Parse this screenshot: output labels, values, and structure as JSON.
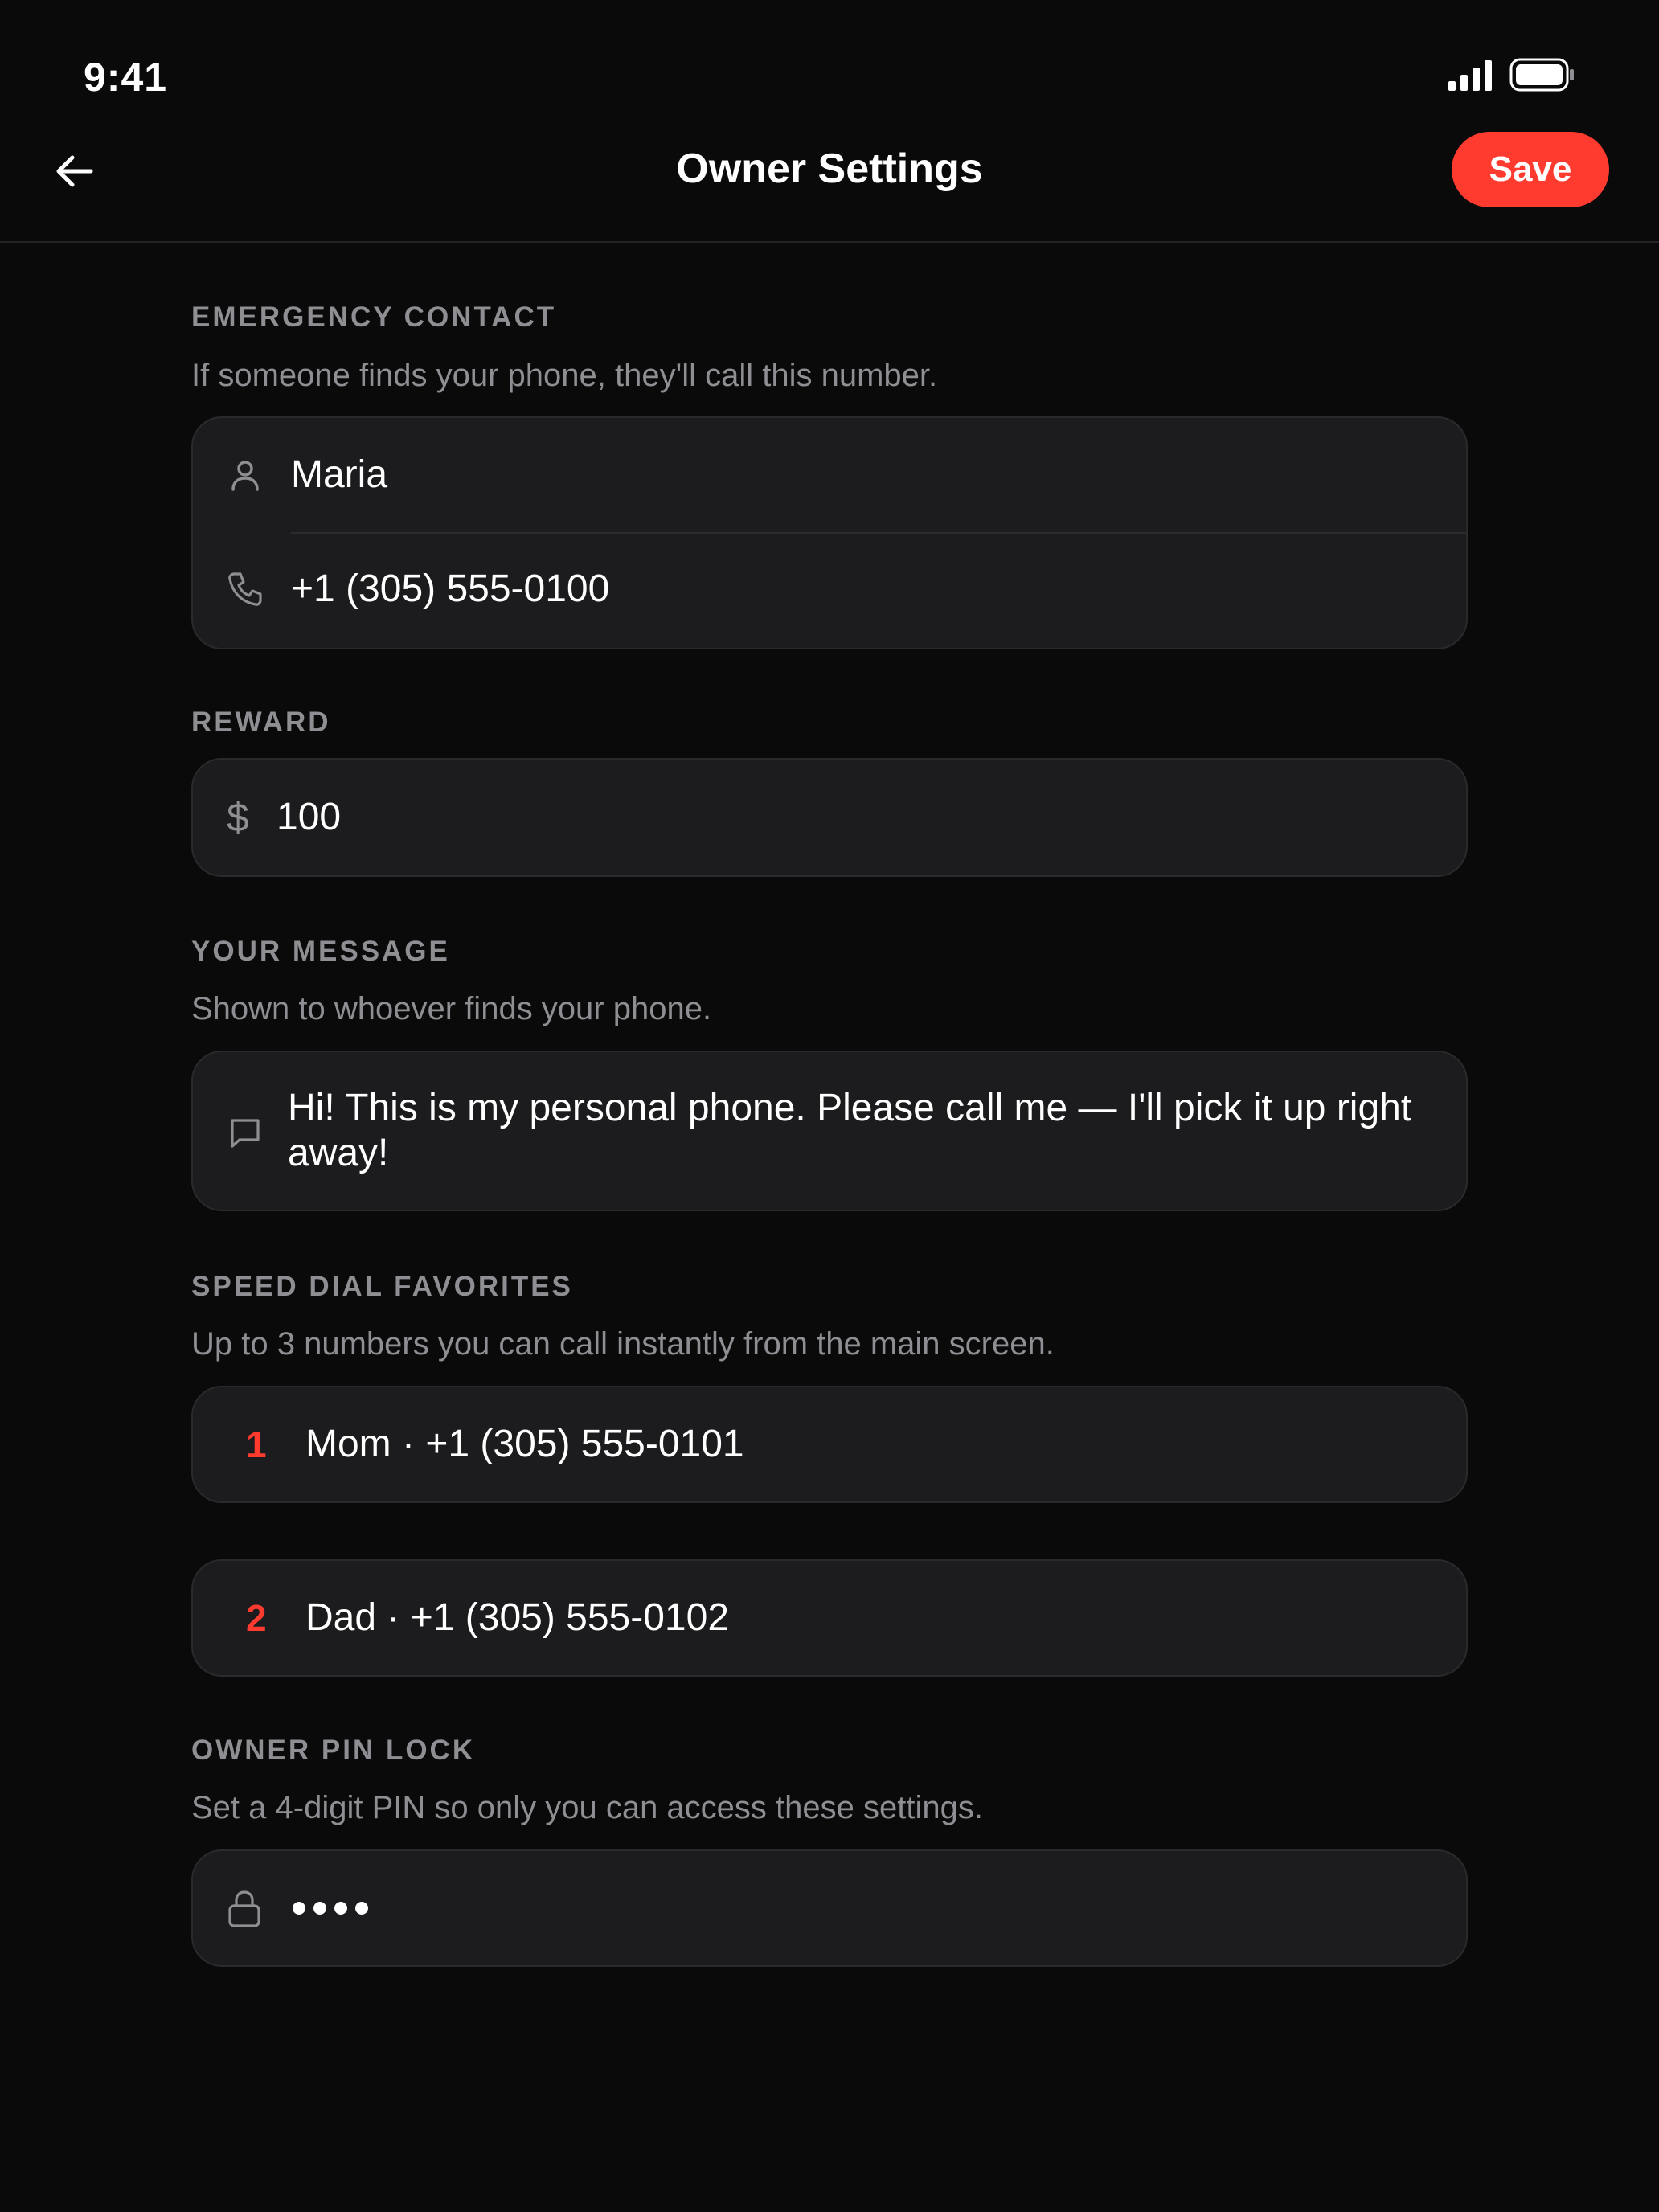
{
  "status_bar": {
    "time": "9:41",
    "signal_icon": "cellular-signal-icon",
    "battery_icon": "battery-icon"
  },
  "nav": {
    "title": "Owner Settings",
    "back_icon": "arrow-left-icon",
    "save_label": "Save"
  },
  "emergency_contact": {
    "label": "EMERGENCY CONTACT",
    "description": "If someone finds your phone, they'll call this number.",
    "name": "Maria",
    "phone": "+1 (305) 555-0100"
  },
  "reward": {
    "label": "REWARD",
    "currency_symbol": "$",
    "amount": "100"
  },
  "message": {
    "label": "YOUR MESSAGE",
    "description": "Shown to whoever finds your phone.",
    "text": "Hi! This is my personal phone. Please call me — I'll pick it up right away!"
  },
  "speed_dial": {
    "label": "SPEED DIAL FAVORITES",
    "description": "Up to 3 numbers you can call instantly from the main screen.",
    "items": [
      {
        "number": "1",
        "text": "Mom · +1 (305) 555-0101"
      },
      {
        "number": "2",
        "text": "Dad · +1 (305) 555-0102"
      }
    ]
  },
  "pin_lock": {
    "label": "OWNER PIN LOCK",
    "description": "Set a 4-digit PIN so only you can access these settings.",
    "pin_length": 4
  },
  "colors": {
    "accent": "#ff3b30",
    "background": "#0a0a0b",
    "card": "#1c1c1e",
    "secondary_text": "#8e8e93"
  }
}
